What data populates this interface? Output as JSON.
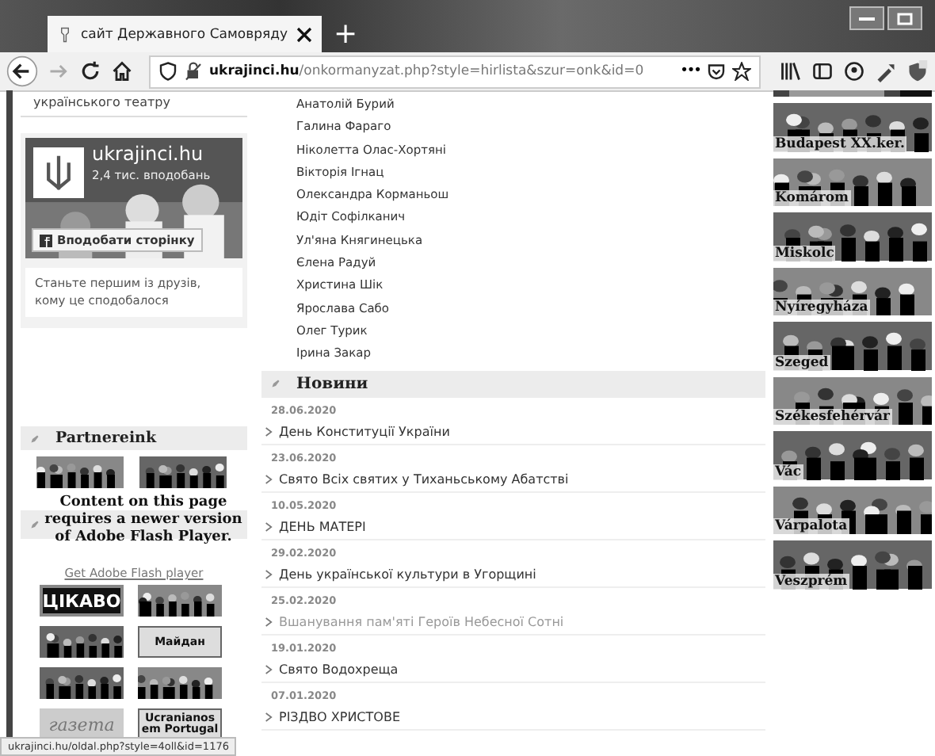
{
  "browser": {
    "tab": {
      "title": "сайт Державного Самовряду",
      "selected": true
    },
    "new_tab": "+",
    "url_host": "ukrajinci.hu",
    "url_path": "/onkormanyzat.php?style=hirlista&szur=onk&id=0",
    "more": "•••"
  },
  "left": {
    "cut_text": "українського театру",
    "facebook": {
      "name": "ukrajinci.hu",
      "likes": "2,4 тис. вподобань",
      "like_button": "Вподобати сторінку",
      "friends_text": "Станьте першим із друзів, кому це сподобалося"
    },
    "partners": {
      "title": "Partnereink",
      "logos": [
        {
          "kind": "picture"
        },
        {
          "kind": "picture"
        }
      ]
    },
    "flash": {
      "message": "Content on this page requires a newer version of Adobe Flash Player.",
      "link": "Get Adobe Flash player"
    },
    "banners": [
      {
        "kind": "dark",
        "text": "ЦІКАВО"
      },
      {
        "kind": "picture"
      },
      {
        "kind": "picture"
      },
      {
        "kind": "light",
        "text": "Майдан"
      },
      {
        "kind": "picture"
      },
      {
        "kind": "picture"
      },
      {
        "kind": "script",
        "text": "газета"
      },
      {
        "kind": "light",
        "text": "Ucranianos em Portugal"
      }
    ]
  },
  "people": [
    "Анатолій Бурий",
    "Галина Фараго",
    "Ніколетта Олас-Хортяні",
    "Вікторія Ігнац",
    "Олександра Корманьош",
    "Юдіт Софілканич",
    "Ул'яна Княгинецька",
    "Єлена Радуй",
    "Христина Шік",
    "Ярослава Сабо",
    "Олег Турик",
    "Ірина Закар"
  ],
  "news": {
    "title": "Новини",
    "items": [
      {
        "date": "28.06.2020",
        "title": "День Конституції України",
        "visited": false
      },
      {
        "date": "23.06.2020",
        "title": "Свято Всіх святих у Тиханьському Абатстві",
        "visited": false
      },
      {
        "date": "10.05.2020",
        "title": "ДЕНЬ МАТЕРІ",
        "visited": false
      },
      {
        "date": "29.02.2020",
        "title": "День української культури в Угорщині",
        "visited": false
      },
      {
        "date": "25.02.2020",
        "title": "Вшанування пам'яті Героїв Небесної Сотні",
        "visited": true
      },
      {
        "date": "19.01.2020",
        "title": "Свято Водохреща",
        "visited": false
      },
      {
        "date": "07.01.2020",
        "title": "РІЗДВО ХРИСТОВЕ",
        "visited": false
      }
    ]
  },
  "cities": [
    "Budapest XX.ker.",
    "Komárom",
    "Miskolc",
    "Nyíregyháza",
    "Szeged",
    "Székesfehérvár",
    "Vác",
    "Várpalota",
    "Veszprém"
  ],
  "status_url": "ukrajinci.hu/oldal.php?style=4oll&id=1176"
}
